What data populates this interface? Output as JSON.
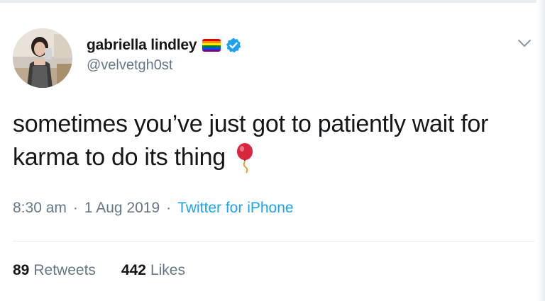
{
  "author": {
    "display_name": "gabriella lindley",
    "handle": "@velvetgh0st",
    "badges": [
      "rainbow-flag-icon",
      "verified-badge-icon"
    ]
  },
  "tweet": {
    "text": "sometimes you’ve just got to patiently wait for karma to do its thing",
    "emoji": "balloon-icon"
  },
  "meta": {
    "time": "8:30 am",
    "date": "1 Aug 2019",
    "separator": "·",
    "source": "Twitter for iPhone"
  },
  "stats": {
    "retweets_count": "89",
    "retweets_label": "Retweets",
    "likes_count": "442",
    "likes_label": "Likes"
  },
  "colors": {
    "link_blue": "#1da1f2",
    "secondary_text": "#657786",
    "primary_text": "#14171a",
    "divider": "#e6ecf0"
  }
}
